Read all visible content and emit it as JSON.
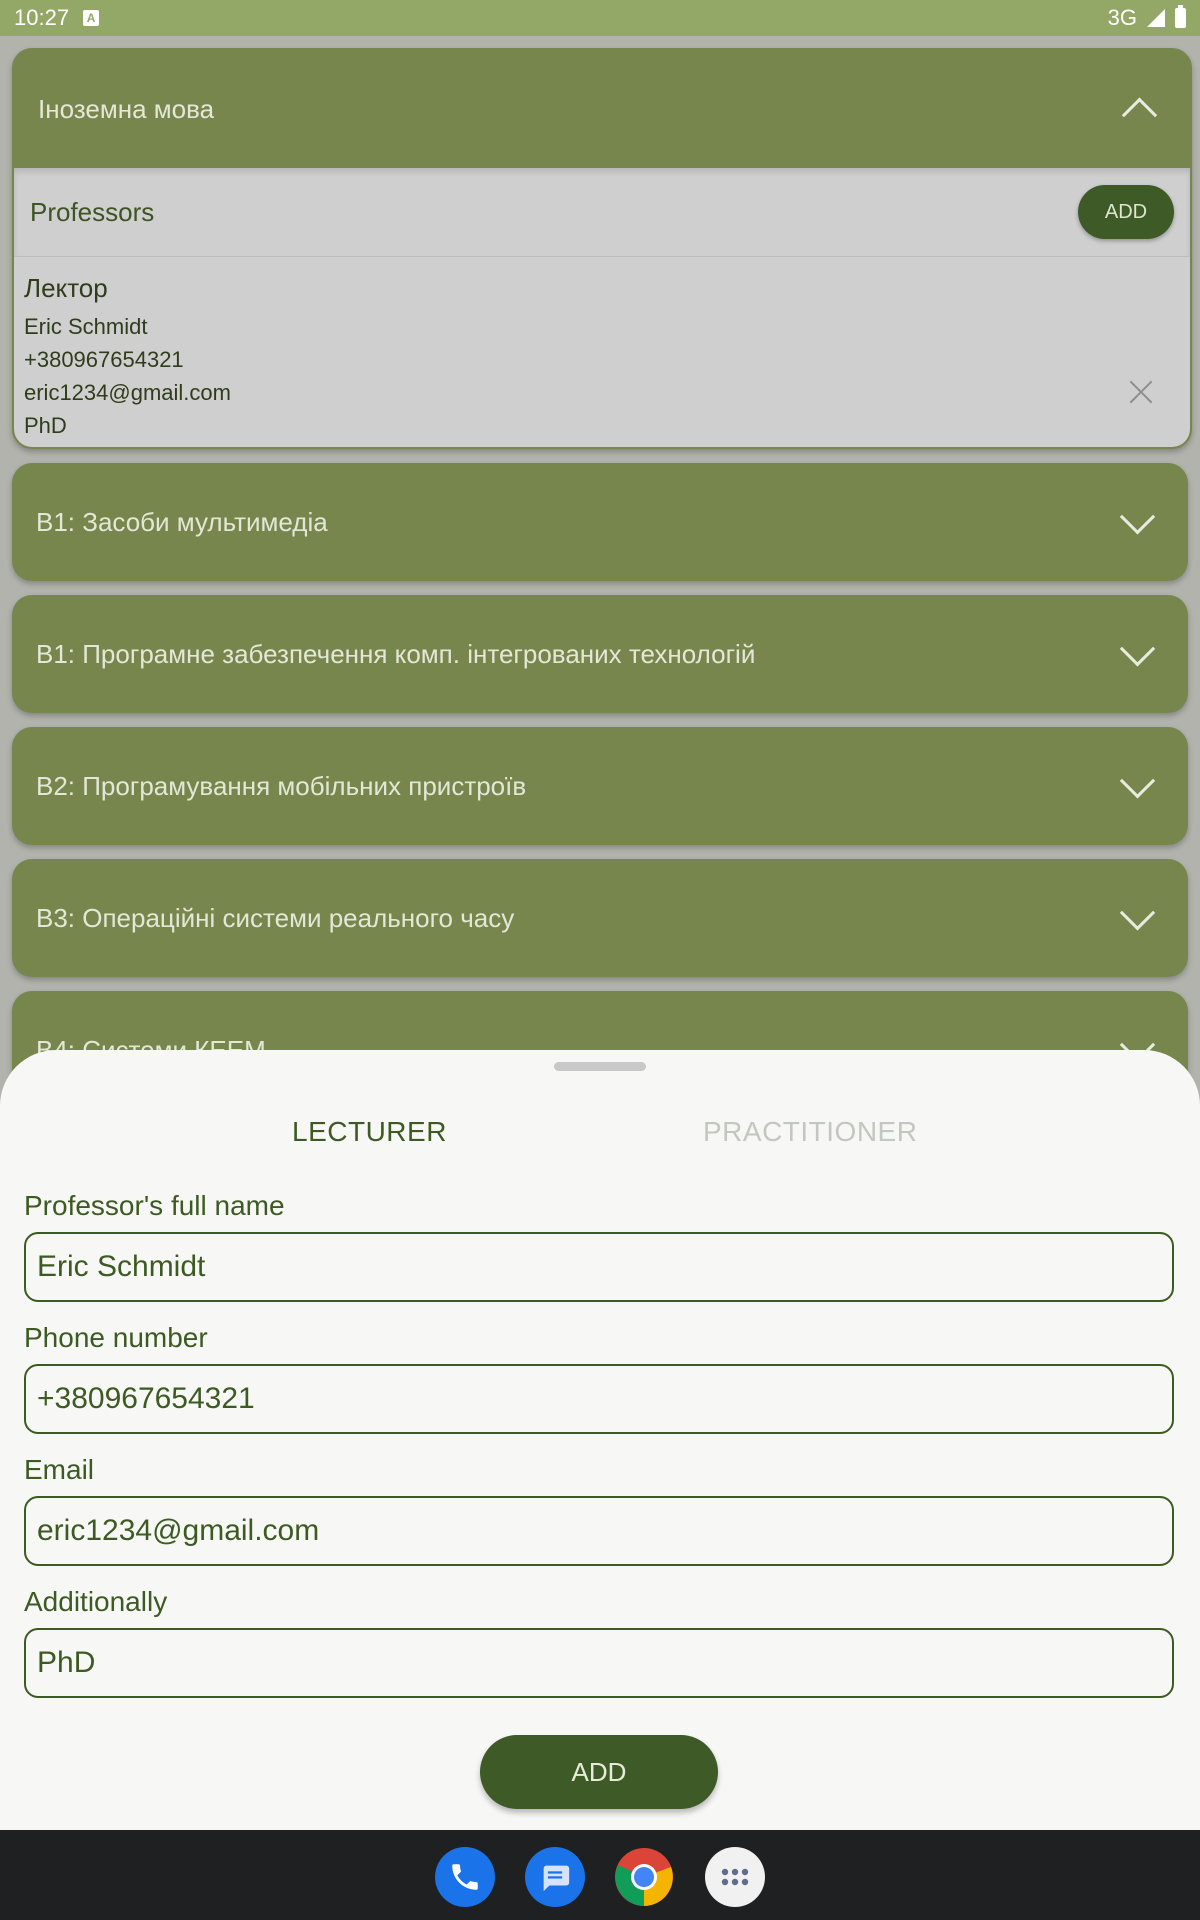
{
  "status_bar": {
    "time": "10:27",
    "network": "3G",
    "notification_icon": "A"
  },
  "accordions": [
    {
      "title": "Іноземна мова",
      "expanded": true
    },
    {
      "title": "В1: Засоби мультимедіа",
      "expanded": false
    },
    {
      "title": "В1: Програмне забезпечення комп. інтегрованих технологій",
      "expanded": false
    },
    {
      "title": "В2: Програмування мобільних пристроїв",
      "expanded": false
    },
    {
      "title": "В3: Операційні системи реального часу",
      "expanded": false
    },
    {
      "title": "В4: Системи КЕЕМ",
      "expanded": false
    }
  ],
  "professors_section": {
    "title": "Professors",
    "add_label": "ADD",
    "entry": {
      "role": "Лектор",
      "name": "Eric Schmidt",
      "phone": "+380967654321",
      "email": "eric1234@gmail.com",
      "extra": "PhD"
    }
  },
  "sheet": {
    "tabs": [
      {
        "label": "LECTURER",
        "active": true
      },
      {
        "label": "PRACTITIONER",
        "active": false
      }
    ],
    "fields": {
      "name": {
        "label": "Professor's full name",
        "value": "Eric Schmidt"
      },
      "phone": {
        "label": "Phone number",
        "value": "+380967654321"
      },
      "email": {
        "label": "Email",
        "value": "eric1234@gmail.com"
      },
      "additional": {
        "label": "Additionally",
        "value": "PhD"
      }
    },
    "submit_label": "ADD"
  },
  "dock": [
    "phone-icon",
    "messages-icon",
    "chrome-icon",
    "apps-icon"
  ],
  "colors": {
    "accent": "#76864d",
    "dark": "#3e5a27",
    "status": "#93a866"
  }
}
